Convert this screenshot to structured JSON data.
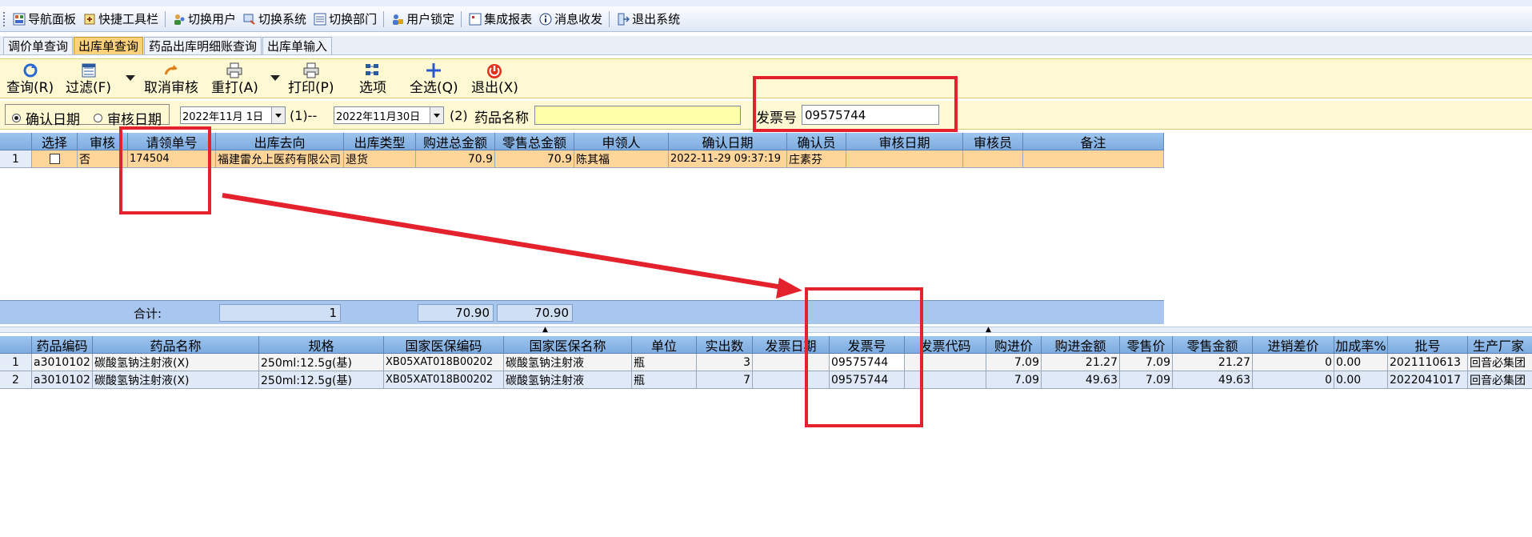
{
  "menubar": {
    "items": [
      {
        "label": "导航面板",
        "icon": "navigation-panel-icon"
      },
      {
        "label": "快捷工具栏",
        "icon": "quick-toolbar-icon"
      },
      {
        "label": "切换用户",
        "icon": "switch-user-icon"
      },
      {
        "label": "切换系统",
        "icon": "switch-system-icon"
      },
      {
        "label": "切换部门",
        "icon": "switch-department-icon"
      },
      {
        "label": "用户锁定",
        "icon": "user-lock-icon"
      },
      {
        "label": "集成报表",
        "icon": "report-icon"
      },
      {
        "label": "消息收发",
        "icon": "info-icon"
      },
      {
        "label": "退出系统",
        "icon": "exit-system-icon"
      }
    ]
  },
  "tabs": [
    {
      "label": "调价单查询"
    },
    {
      "label": "出库单查询",
      "active": true
    },
    {
      "label": "药品出库明细账查询"
    },
    {
      "label": "出库单输入"
    }
  ],
  "toolbar": {
    "query": "查询(R)",
    "filter": "过滤(F)",
    "cancel_audit": "取消审核",
    "reprint": "重打(A)",
    "print": "打印(P)",
    "options": "选项",
    "select_all": "全选(Q)",
    "exit": "退出(X)"
  },
  "filter": {
    "confirm_date_label": "确认日期",
    "audit_date_label": "审核日期",
    "date_from": "2022年11月 1日",
    "from_suffix": "(1)--",
    "date_to": "2022年11月30日",
    "to_suffix": "(2)",
    "drug_name_label": "药品名称",
    "drug_name_value": "",
    "invoice_label": "发票号",
    "invoice_value": "09575744"
  },
  "top_grid": {
    "columns": [
      "选择",
      "审核",
      "请领单号",
      "出库去向",
      "出库类型",
      "购进总金额",
      "零售总金额",
      "申领人",
      "确认日期",
      "确认员",
      "审核日期",
      "审核员",
      "备注"
    ],
    "rows": [
      {
        "no": "1",
        "select": "",
        "audit": "否",
        "req_no": "174504",
        "dest": "福建雷允上医药有限公司",
        "type": "退货",
        "purchase_total": "70.9",
        "retail_total": "70.9",
        "applicant": "陈其福",
        "confirm_date": "2022-11-29 09:37:19",
        "confirmer": "庄素芬",
        "audit_date": "",
        "auditor": "",
        "remark": ""
      }
    ],
    "summary": {
      "label": "合计:",
      "count": "1",
      "purchase_total": "70.90",
      "retail_total": "70.90"
    }
  },
  "bottom_grid": {
    "columns": [
      "药品编码",
      "药品名称",
      "规格",
      "国家医保编码",
      "国家医保名称",
      "单位",
      "实出数",
      "发票日期",
      "发票号",
      "发票代码",
      "购进价",
      "购进金额",
      "零售价",
      "零售金额",
      "进销差价",
      "加成率%",
      "批号",
      "生产厂家"
    ],
    "rows": [
      {
        "no": "1",
        "code": "a3010102",
        "name": "碳酸氢钠注射液(X)",
        "spec": "250ml:12.5g(基)",
        "nhsa_code": "XB05XAT018B00202",
        "nhsa_name": "碳酸氢钠注射液",
        "unit": "瓶",
        "qty": "3",
        "inv_date": "",
        "inv_no": "09575744",
        "inv_code": "",
        "price": "7.09",
        "amount": "21.27",
        "retail_price": "7.09",
        "retail_amount": "21.27",
        "diff": "0",
        "markup": "0.00",
        "batch": "2021110613",
        "maker": "回音必集团"
      },
      {
        "no": "2",
        "code": "a3010102",
        "name": "碳酸氢钠注射液(X)",
        "spec": "250ml:12.5g(基)",
        "nhsa_code": "XB05XAT018B00202",
        "nhsa_name": "碳酸氢钠注射液",
        "unit": "瓶",
        "qty": "7",
        "inv_date": "",
        "inv_no": "09575744",
        "inv_code": "",
        "price": "7.09",
        "amount": "49.63",
        "retail_price": "7.09",
        "retail_amount": "49.63",
        "diff": "0",
        "markup": "0.00",
        "batch": "2022041017",
        "maker": "回音必集团"
      }
    ]
  },
  "colors": {
    "annotation_red": "#e3222d",
    "selected_row": "#ffd59a",
    "toolbar_bg": "#fff9d3",
    "header_blue": "#8fb8e8"
  }
}
